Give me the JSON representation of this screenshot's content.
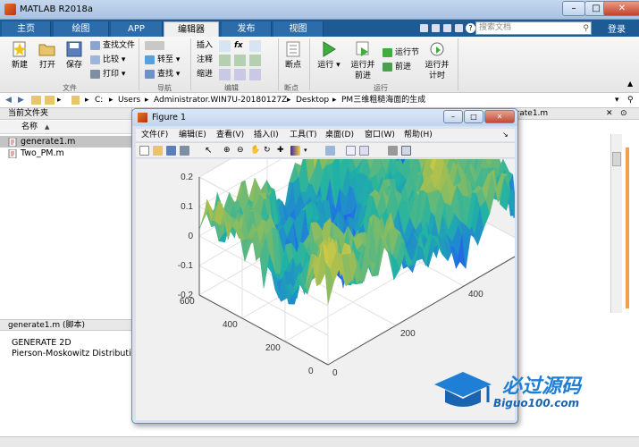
{
  "window": {
    "title": "MATLAB R2018a",
    "min": "–",
    "max": "□",
    "close": "✕"
  },
  "tabs": [
    "主页",
    "绘图",
    "APP",
    "编辑器",
    "发布",
    "视图"
  ],
  "search": {
    "placeholder": "搜索文档"
  },
  "login": "登录",
  "ribbon": {
    "new": "新建",
    "open": "打开",
    "save": "保存",
    "find_files": "查找文件",
    "compare": "比较",
    "print": "打印",
    "goto": "转至",
    "find": "查找",
    "insert": "插入",
    "comment": "注释",
    "indent": "缩进",
    "fx": "fx",
    "breakpoints": "断点",
    "run": "运行",
    "run_advance": "运行并前进",
    "run_section": "运行节",
    "advance": "前进",
    "run_time": "运行并计时",
    "groups": {
      "file": "文件",
      "nav": "导航",
      "edit": "编辑",
      "bp": "断点",
      "run": "运行"
    }
  },
  "address": [
    "C:",
    "Users",
    "Administrator.WIN7U-20180127Z",
    "Desktop",
    "PM三维粗糙海面的生成"
  ],
  "current_folder": {
    "title": "当前文件夹",
    "col_name": "名称",
    "sort_arrow": "▲",
    "files": [
      {
        "name": "generate1.m",
        "selected": true
      },
      {
        "name": "Two_PM.m",
        "selected": false
      }
    ]
  },
  "details": {
    "title": "generate1.m  (脚本)",
    "lines": [
      "GENERATE 2D",
      "Pierson-Moskowitz Distribution"
    ]
  },
  "editor_tab_partial": "erate1.m",
  "figure": {
    "title": "Figure 1",
    "menus": [
      "文件(F)",
      "编辑(E)",
      "查看(V)",
      "插入(I)",
      "工具(T)",
      "桌面(D)",
      "窗口(W)",
      "帮助(H)"
    ]
  },
  "chart_data": {
    "type": "surface",
    "title": "",
    "xlabel": "",
    "ylabel": "",
    "zlabel": "",
    "x_ticks": [
      0,
      200,
      400,
      600
    ],
    "y_ticks": [
      0,
      200,
      400,
      600
    ],
    "z_ticks": [
      -0.2,
      -0.1,
      0,
      0.1,
      0.2
    ],
    "xlim": [
      0,
      600
    ],
    "ylim": [
      0,
      600
    ],
    "zlim": [
      -0.2,
      0.2
    ],
    "colormap": "parula",
    "colors": {
      "low": "#3e26a8",
      "mid": "#20b3a4",
      "high": "#f9d63b"
    }
  },
  "watermark": {
    "cn": "必过源码",
    "en": "Biguo100.com"
  }
}
